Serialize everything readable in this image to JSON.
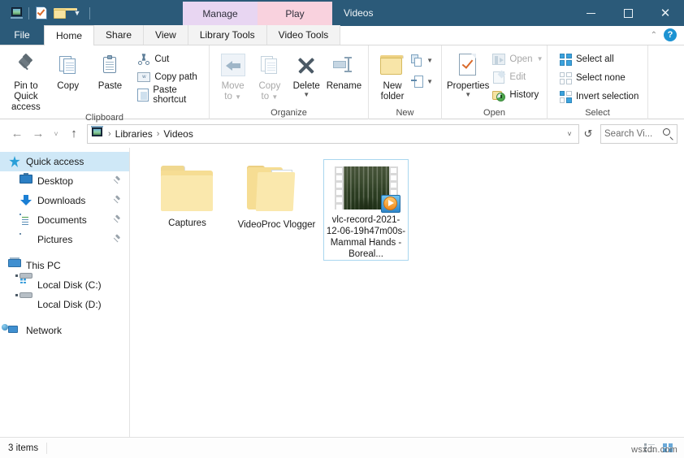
{
  "titlebar": {
    "quick_access_icons": [
      "video-library-icon",
      "properties-icon",
      "new-folder-icon",
      "customize-qat-caret"
    ],
    "contextual_tabs": [
      {
        "label": "Manage",
        "color": "#e8d6f2"
      },
      {
        "label": "Play",
        "color": "#f9d2de"
      }
    ],
    "window_title": "Videos",
    "minimize_label": "—",
    "maximize_label": "",
    "close_label": "✕"
  },
  "tabs": {
    "file": "File",
    "items": [
      {
        "label": "Home",
        "active": true
      },
      {
        "label": "Share",
        "active": false
      },
      {
        "label": "View",
        "active": false
      },
      {
        "label": "Library Tools",
        "active": false
      },
      {
        "label": "Video Tools",
        "active": false
      }
    ],
    "collapse_caret": "⌃",
    "help_label": "?"
  },
  "ribbon": {
    "groups": [
      {
        "name": "Clipboard",
        "label": "Clipboard",
        "big_buttons": [
          {
            "label": "Pin to Quick\naccess",
            "line1": "Pin to Quick",
            "line2": "access",
            "icon": "pin-icon",
            "disabled": false
          },
          {
            "label": "Copy",
            "line1": "Copy",
            "line2": "",
            "icon": "copy-pages-icon",
            "disabled": false
          },
          {
            "label": "Paste",
            "line1": "Paste",
            "line2": "",
            "icon": "clipboard-icon",
            "disabled": false
          }
        ],
        "small_buttons": [
          {
            "label": "Cut",
            "icon": "scissors-icon",
            "disabled": false
          },
          {
            "label": "Copy path",
            "icon": "copy-path-icon",
            "disabled": false
          },
          {
            "label": "Paste shortcut",
            "icon": "paste-shortcut-icon",
            "disabled": false
          }
        ]
      },
      {
        "name": "Organize",
        "label": "Organize",
        "big_buttons": [
          {
            "line1": "Move",
            "line2": "to",
            "icon": "move-to-icon",
            "disabled": true,
            "has_caret": true
          },
          {
            "line1": "Copy",
            "line2": "to",
            "icon": "copy-to-icon",
            "disabled": true,
            "has_caret": true
          },
          {
            "line1": "Delete",
            "line2": "",
            "icon": "delete-x-icon",
            "disabled": false,
            "has_caret": true
          },
          {
            "line1": "Rename",
            "line2": "",
            "icon": "rename-icon",
            "disabled": false,
            "has_caret": false
          }
        ]
      },
      {
        "name": "New",
        "label": "New",
        "big_buttons": [
          {
            "line1": "New",
            "line2": "folder",
            "icon": "new-folder-icon",
            "disabled": false
          }
        ],
        "small_buttons": [
          {
            "label": "",
            "icon": "new-item-icon",
            "disabled": false,
            "has_caret": true
          },
          {
            "label": "",
            "icon": "easy-access-icon",
            "disabled": false,
            "has_caret": true
          }
        ]
      },
      {
        "name": "Open",
        "label": "Open",
        "big_buttons": [
          {
            "line1": "Properties",
            "line2": "",
            "icon": "properties-icon",
            "disabled": false,
            "has_caret": true
          }
        ],
        "small_buttons": [
          {
            "label": "Open",
            "icon": "open-icon",
            "disabled": true,
            "has_caret": true
          },
          {
            "label": "Edit",
            "icon": "edit-icon",
            "disabled": true
          },
          {
            "label": "History",
            "icon": "history-icon",
            "disabled": false
          }
        ]
      },
      {
        "name": "Select",
        "label": "Select",
        "small_buttons": [
          {
            "label": "Select all",
            "icon": "select-all-icon",
            "disabled": false
          },
          {
            "label": "Select none",
            "icon": "select-none-icon",
            "disabled": false
          },
          {
            "label": "Invert selection",
            "icon": "invert-selection-icon",
            "disabled": false
          }
        ]
      }
    ]
  },
  "addressbar": {
    "back_icon": "←",
    "forward_icon": "→",
    "recent_icon": "˅",
    "up_icon": "↑",
    "breadcrumbs": [
      "Libraries",
      "Videos"
    ],
    "separator": "›",
    "dropdown_icon": "˅",
    "refresh_icon": "↺",
    "search_placeholder": "Search Vi...",
    "search_value": ""
  },
  "navpane": {
    "sections": [
      {
        "root": {
          "label": "Quick access",
          "icon": "quick-access-star-icon",
          "selected": true
        },
        "children": [
          {
            "label": "Desktop",
            "icon": "desktop-icon",
            "pinned": true
          },
          {
            "label": "Downloads",
            "icon": "downloads-icon",
            "pinned": true
          },
          {
            "label": "Documents",
            "icon": "documents-icon",
            "pinned": true
          },
          {
            "label": "Pictures",
            "icon": "pictures-icon",
            "pinned": true
          }
        ]
      },
      {
        "root": {
          "label": "This PC",
          "icon": "this-pc-icon",
          "selected": false
        },
        "children": [
          {
            "label": "Local Disk (C:)",
            "icon": "system-drive-icon",
            "pinned": false
          },
          {
            "label": "Local Disk (D:)",
            "icon": "drive-icon",
            "pinned": false
          }
        ]
      },
      {
        "root": {
          "label": "Network",
          "icon": "network-icon",
          "selected": false
        },
        "children": []
      }
    ]
  },
  "files": [
    {
      "name": "Captures",
      "type": "folder",
      "icon": "folder-icon",
      "selected": false
    },
    {
      "name": "VideoProc Vlogger",
      "type": "folder",
      "icon": "folder-with-contents-icon",
      "selected": false
    },
    {
      "name": "vlc-record-2021-12-06-19h47m00s-Mammal Hands - Boreal...",
      "type": "video",
      "icon": "video-thumbnail",
      "selected": true
    }
  ],
  "statusbar": {
    "item_count": "3 items",
    "view_details_icon": "details-view-icon",
    "view_icons_icon": "large-icons-view-icon"
  },
  "watermark": "wsxdn.com"
}
